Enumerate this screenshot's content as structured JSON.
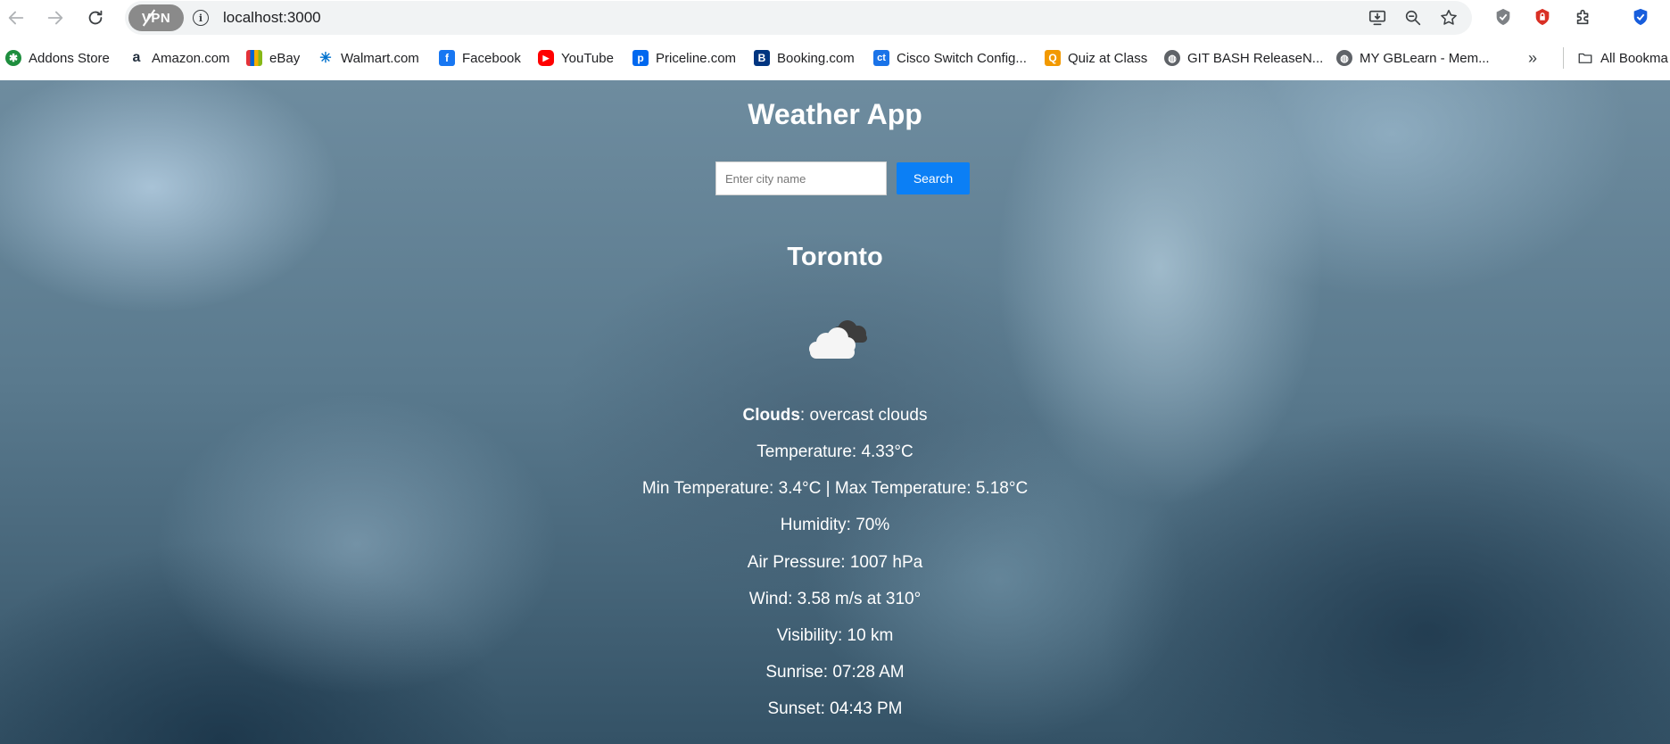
{
  "browser": {
    "url": "localhost:3000",
    "vpn_label": "VPN"
  },
  "bookmarks": [
    {
      "label": "Addons Store",
      "icon": "addons-store-icon",
      "color": "#1e8e3e"
    },
    {
      "label": "Amazon.com",
      "icon": "amazon-icon",
      "color": "#232f3e"
    },
    {
      "label": "eBay",
      "icon": "ebay-icon",
      "color": "#e53238"
    },
    {
      "label": "Walmart.com",
      "icon": "walmart-icon",
      "color": "#0071ce"
    },
    {
      "label": "Facebook",
      "icon": "facebook-icon",
      "color": "#1877f2"
    },
    {
      "label": "YouTube",
      "icon": "youtube-icon",
      "color": "#ff0000"
    },
    {
      "label": "Priceline.com",
      "icon": "priceline-icon",
      "color": "#0068ef"
    },
    {
      "label": "Booking.com",
      "icon": "booking-icon",
      "color": "#003580"
    },
    {
      "label": "Cisco Switch Config...",
      "icon": "cisco-icon",
      "color": "#1a73e8"
    },
    {
      "label": "Quiz at Class",
      "icon": "quiz-icon",
      "color": "#f29900"
    },
    {
      "label": "GIT BASH ReleaseN...",
      "icon": "globe-icon",
      "color": "#5f6368"
    },
    {
      "label": "MY GBLearn - Mem...",
      "icon": "globe-icon",
      "color": "#5f6368"
    }
  ],
  "all_bookmarks_label": "All Bookma",
  "app": {
    "title": "Weather App",
    "search_placeholder": "Enter city name",
    "search_button": "Search",
    "city": "Toronto",
    "icon": "cloud-icon",
    "condition_label": "Clouds",
    "condition_desc": ": overcast clouds",
    "temperature": "Temperature: 4.33°C",
    "min_max": "Min Temperature: 3.4°C | Max Temperature: 5.18°C",
    "humidity": "Humidity: 70%",
    "pressure": "Air Pressure: 1007 hPa",
    "wind": "Wind: 3.58 m/s at 310°",
    "visibility": "Visibility: 10 km",
    "sunrise": "Sunrise: 07:28 AM",
    "sunset": "Sunset: 04:43 PM"
  }
}
